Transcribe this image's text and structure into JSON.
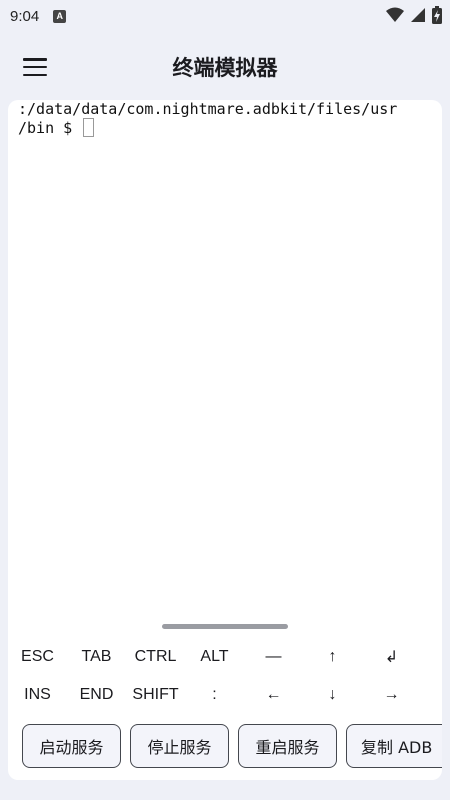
{
  "status_bar": {
    "time": "9:04",
    "notification_icon": "A",
    "icons": [
      "wifi-icon",
      "signal-icon",
      "battery-charging-icon"
    ]
  },
  "app_bar": {
    "title": "终端模拟器",
    "menu_icon": "hamburger-menu-icon"
  },
  "terminal": {
    "lines": [
      ":/data/data/com.nightmare.adbkit/files/usr",
      "/bin $ "
    ]
  },
  "extra_keys": {
    "row1": [
      "ESC",
      "TAB",
      "CTRL",
      "ALT",
      "—",
      "↑",
      "↲"
    ],
    "row2": [
      "INS",
      "END",
      "SHIFT",
      ":",
      "←",
      "↓",
      "→"
    ]
  },
  "actions": {
    "start_service": "启动服务",
    "stop_service": "停止服务",
    "restart_service": "重启服务",
    "copy_adb": "复制 ADB"
  },
  "colors": {
    "background": "#eef0f7",
    "card": "#ffffff",
    "button_border": "#44474e"
  }
}
